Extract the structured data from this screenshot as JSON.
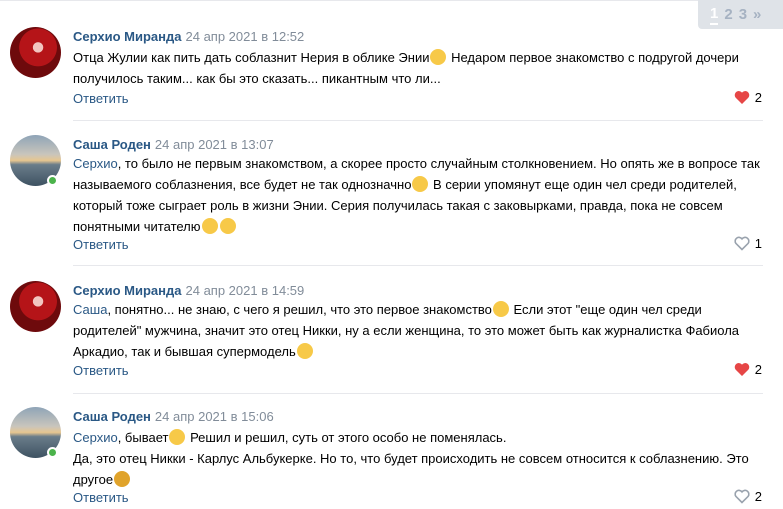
{
  "pagination": {
    "pages": [
      "1",
      "2",
      "3"
    ],
    "current": "1",
    "more": "»"
  },
  "comments": [
    {
      "author": "Серхио Миранда",
      "date": "24 апр 2021 в 12:52",
      "avatar": "red-masked-figure",
      "online": false,
      "text_parts": [
        "Отца Жулии как пить дать соблазнит Нерия в облике Энии",
        " Недаром первое знакомство с подругой дочери получилось таким... как бы это сказать... пикантным что ли..."
      ],
      "emojis": [
        "smirk-emoji"
      ],
      "reply_label": "Ответить",
      "likes": "2",
      "liked": true
    },
    {
      "author": "Саша Роден",
      "date": "24 апр 2021 в 13:07",
      "avatar": "seascape",
      "online": true,
      "reply_to": "Серхио",
      "text_parts": [
        ", то было не первым знакомством, а скорее просто случайным столкновением. Но опять же в вопросе так называемого соблазнения, все будет не так однозначно",
        " В серии упомянут еще один чел среди родителей, который тоже сыграет роль в жизни Энии. Серия получилась такая с заковырками, правда, пока не совсем понятными читателю"
      ],
      "emojis": [
        "relieved-emoji",
        "upside-down-emoji",
        "grimace-emoji"
      ],
      "reply_label": "Ответить",
      "likes": "1",
      "liked": false
    },
    {
      "author": "Серхио Миранда",
      "date": "24 апр 2021 в 14:59",
      "avatar": "red-masked-figure",
      "online": false,
      "reply_to": "Саша",
      "text_parts": [
        ", понятно... не знаю, с чего я решил, что это первое знакомство",
        " Если этот \"еще один чел среди родителей\" мужчина, значит это отец Никки, ну а если женщина, то это может быть как журналистка Фабиола Аркадио, так и бывшая супермодель"
      ],
      "emojis": [
        "relieved-emoji",
        "smile-emoji"
      ],
      "reply_label": "Ответить",
      "likes": "2",
      "liked": true
    },
    {
      "author": "Саша Роден",
      "date": "24 апр 2021 в 15:06",
      "avatar": "seascape",
      "online": true,
      "reply_to": "Серхио",
      "text_parts": [
        ", бывает",
        " Решил и решил, суть от этого особо не поменялась.",
        "Да, это отец Никки - Карлус Альбукерке. Но то, что будет происходить не совсем относится к соблазнению. Это другое"
      ],
      "emojis": [
        "wink-emoji",
        "cowboy-emoji"
      ],
      "reply_label": "Ответить",
      "likes": "2",
      "liked": false
    }
  ],
  "colors": {
    "author": "#2a5885",
    "date": "#818c99",
    "like_active": "#e64646",
    "like_inactive": "#99a2ad",
    "online": "#4bb34b"
  }
}
